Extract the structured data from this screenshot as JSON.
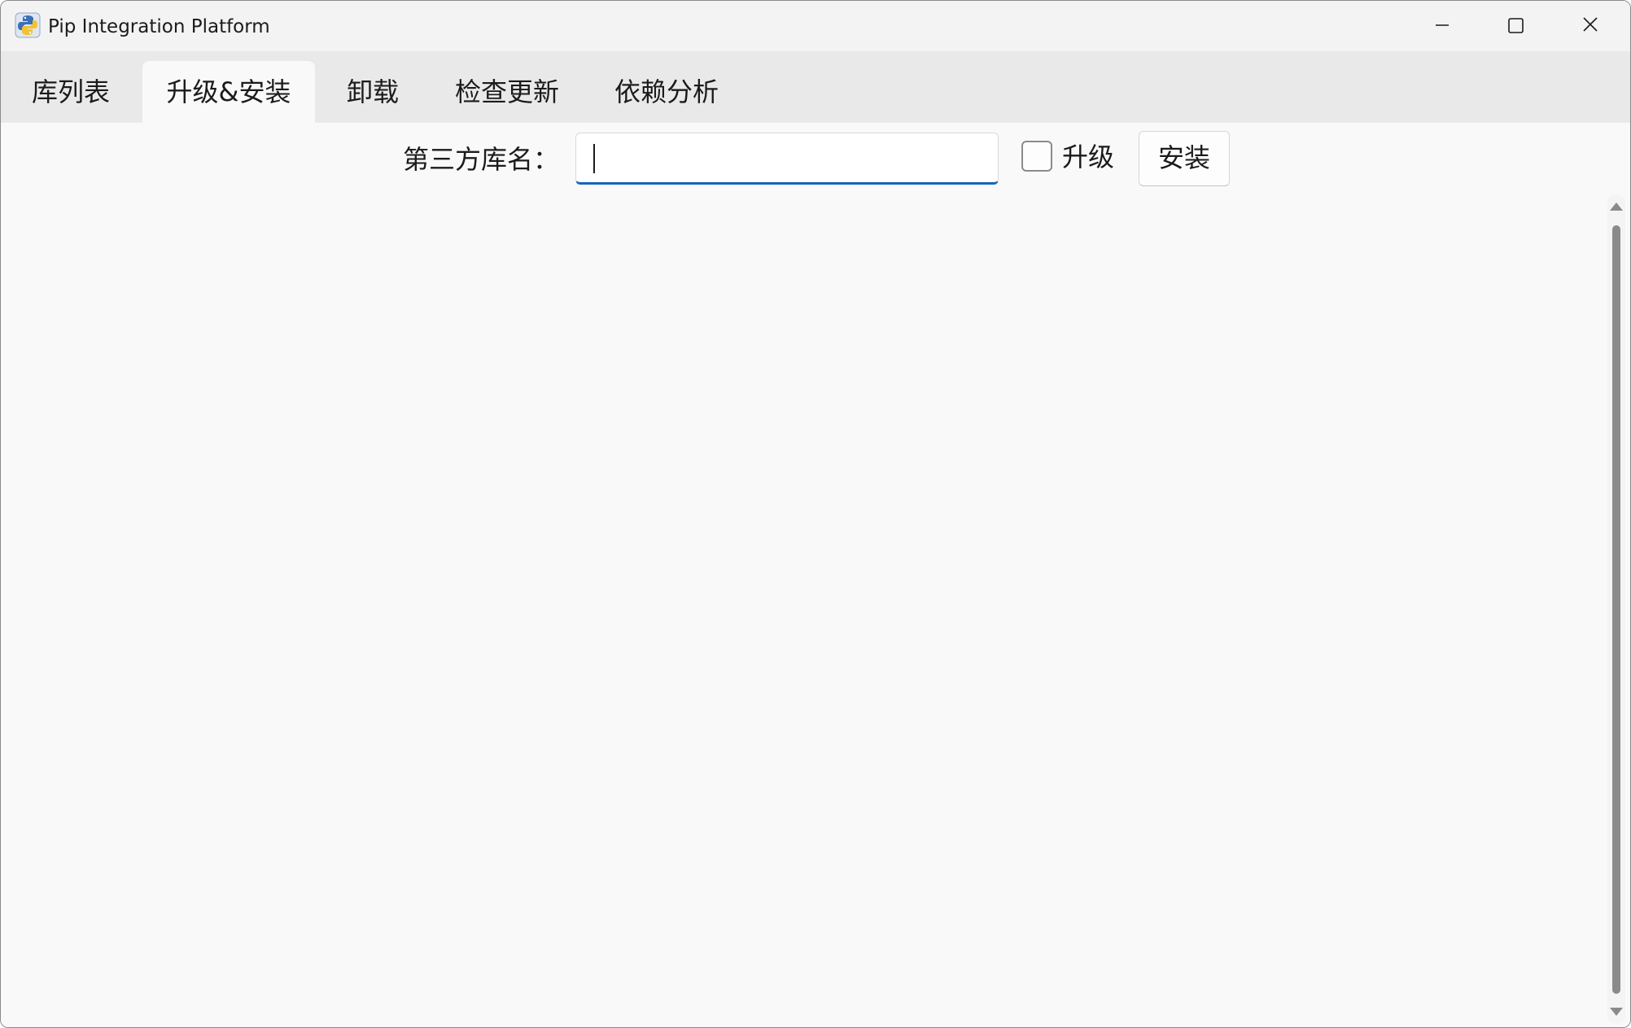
{
  "window": {
    "title": "Pip Integration Platform",
    "app_icon": "python-app-icon",
    "controls": {
      "minimize": "minimize-icon",
      "maximize": "maximize-icon",
      "close": "close-icon"
    }
  },
  "tabs": [
    {
      "label": "库列表",
      "active": false
    },
    {
      "label": "升级&安装",
      "active": true
    },
    {
      "label": "卸载",
      "active": false
    },
    {
      "label": "检查更新",
      "active": false
    },
    {
      "label": "依赖分析",
      "active": false
    }
  ],
  "install_panel": {
    "field_label": "第三方库名：",
    "input_value": "",
    "input_placeholder": "",
    "upgrade_checkbox_label": "升级",
    "upgrade_checked": false,
    "install_button_label": "安装"
  },
  "colors": {
    "accent": "#1565c0",
    "tabbar_bg": "#e9e9e9",
    "content_bg": "#f9f9f9"
  }
}
